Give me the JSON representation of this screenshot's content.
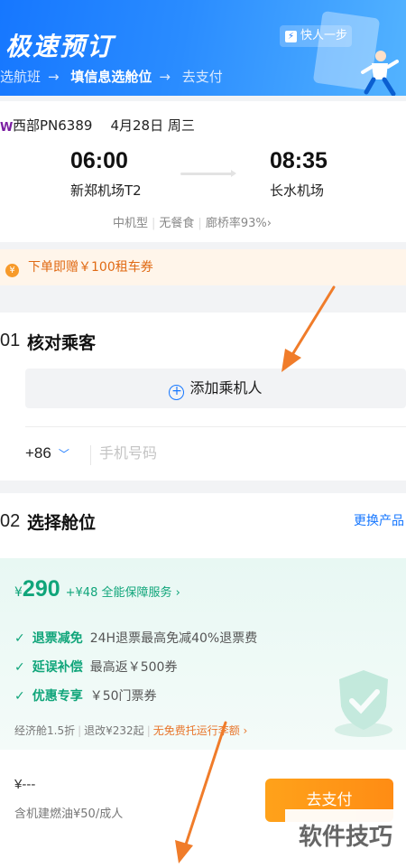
{
  "header": {
    "title": "极速预订",
    "steps": [
      "选航班",
      "填信息选舱位",
      "去支付"
    ],
    "step_arrow": "→",
    "quick_badge": "快人一步",
    "quick_badge_icon": "bolt-icon"
  },
  "flight": {
    "airline_logo": "W",
    "airline": "西部PN6389",
    "date": "4月28日 周三",
    "depart_time": "06:00",
    "depart_airport": "新郑机场T2",
    "arrive_time": "08:35",
    "arrive_airport": "长水机场",
    "info": [
      "中机型",
      "无餐食",
      "廊桥率93%"
    ],
    "info_chevron": "›"
  },
  "promo": {
    "text": "下单即赠￥100租车券"
  },
  "passengers": {
    "number": "01",
    "title": "核对乘客",
    "add_button": "添加乘机人",
    "country_code": "+86",
    "phone_placeholder": "手机号码"
  },
  "cabin": {
    "number": "02",
    "title": "选择舱位",
    "change_link": "更换产品",
    "currency": "¥",
    "price": "290",
    "extra_service": "+¥48 全能保障服务 ›",
    "benefits": [
      {
        "title": "退票减免",
        "desc": "24H退票最高免减40%退票费"
      },
      {
        "title": "延误补偿",
        "desc": "最高返￥500券"
      },
      {
        "title": "优惠专享",
        "desc": "￥50门票券"
      }
    ],
    "fare_class": "经济舱1.5折",
    "change_fee": "退改¥232起",
    "baggage": "无免费托运行李额 ›"
  },
  "footer": {
    "total": "¥---",
    "fee_note": "含机建燃油¥50/成人",
    "pay_button": "去支付"
  },
  "watermark": "软件技巧",
  "colors": {
    "header_blue": "#1677ff",
    "accent_green": "#10a57a",
    "promo_orange": "#e06a14",
    "pay_orange": "#ff8c14",
    "annotation_arrow": "#f07c2a"
  }
}
